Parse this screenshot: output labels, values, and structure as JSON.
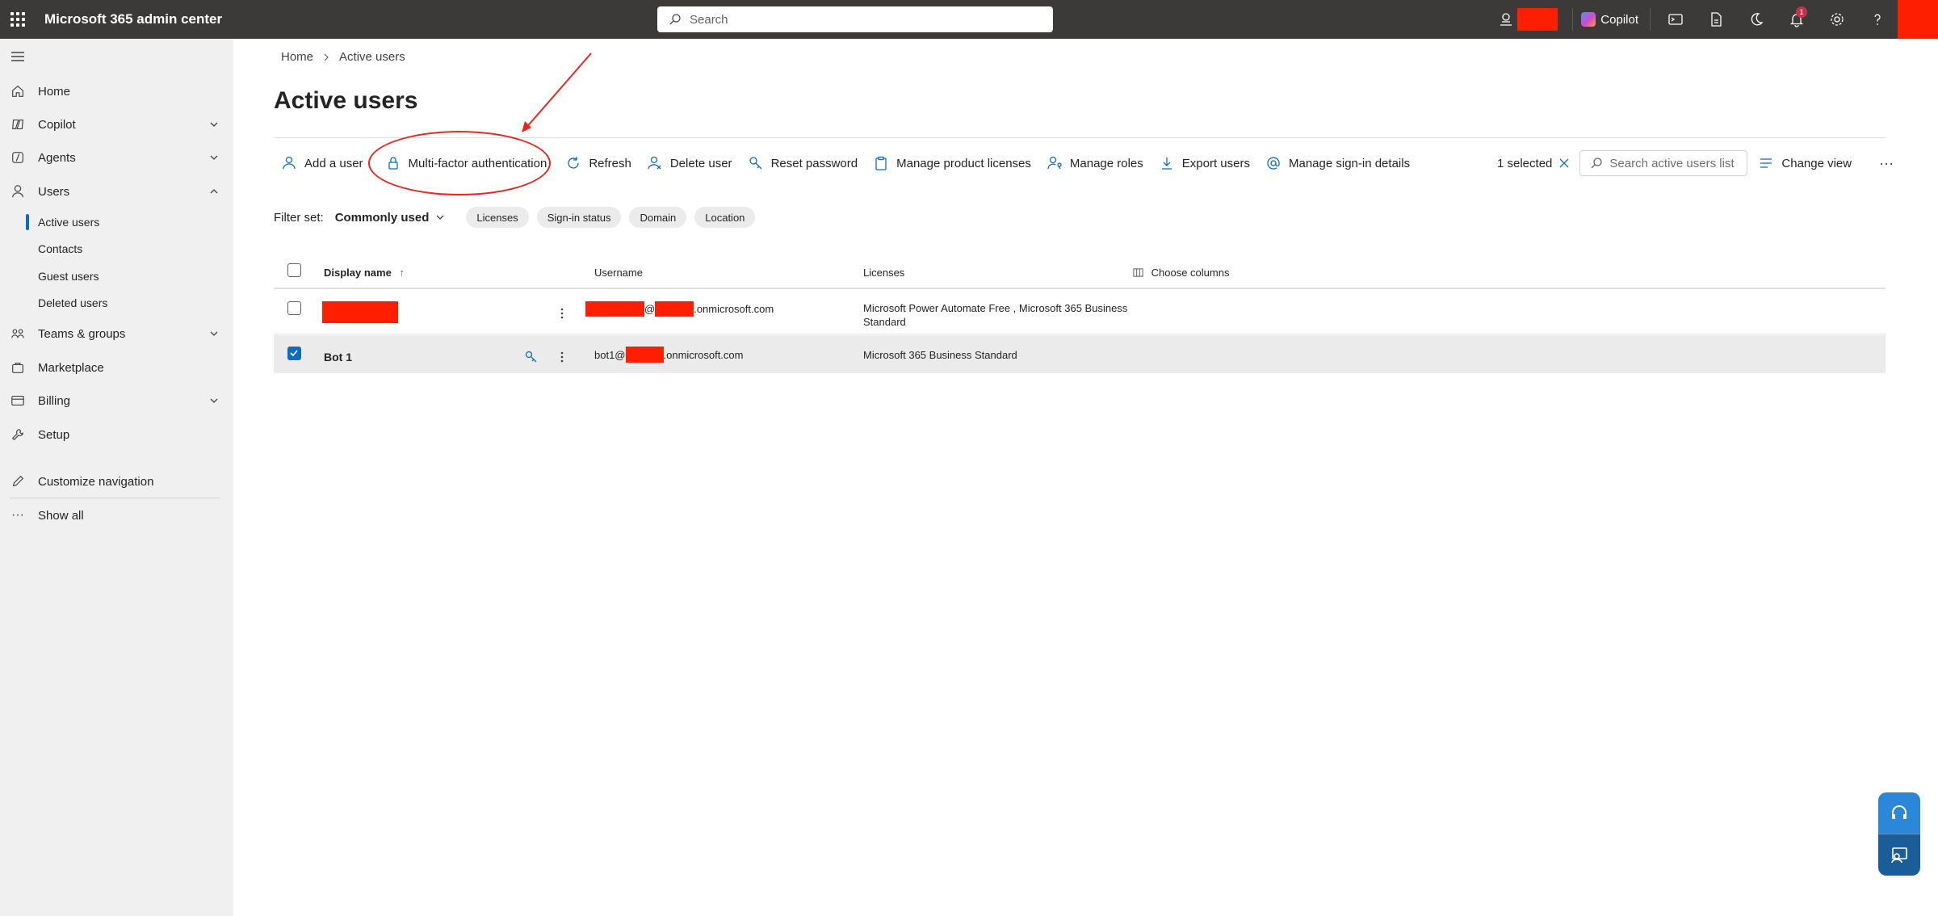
{
  "header": {
    "app_title": "Microsoft 365 admin center",
    "search_placeholder": "Search",
    "copilot_label": "Copilot",
    "notification_count": "1"
  },
  "nav": {
    "items": [
      {
        "label": "Home",
        "icon": "home-icon"
      },
      {
        "label": "Copilot",
        "icon": "copilot-icon"
      },
      {
        "label": "Agents",
        "icon": "agents-icon"
      },
      {
        "label": "Users",
        "icon": "person-icon"
      },
      {
        "label": "Teams & groups",
        "icon": "teams-icon"
      },
      {
        "label": "Marketplace",
        "icon": "bag-icon"
      },
      {
        "label": "Billing",
        "icon": "card-icon"
      },
      {
        "label": "Setup",
        "icon": "wrench-icon"
      },
      {
        "label": "Customize navigation",
        "icon": "pencil-icon"
      },
      {
        "label": "Show all",
        "icon": "more-icon"
      }
    ],
    "users_sub": [
      "Active users",
      "Contacts",
      "Guest users",
      "Deleted users"
    ]
  },
  "breadcrumb": {
    "home": "Home",
    "current": "Active users"
  },
  "page_title": "Active users",
  "toolbar": {
    "add_user": "Add a user",
    "mfa": "Multi-factor authentication",
    "refresh": "Refresh",
    "delete_user": "Delete user",
    "reset_password": "Reset password",
    "manage_licenses": "Manage product licenses",
    "manage_roles": "Manage roles",
    "export_users": "Export users",
    "manage_signin": "Manage sign-in details",
    "selected": "1 selected",
    "search_placeholder": "Search active users list",
    "change_view": "Change view"
  },
  "filter": {
    "label": "Filter set:",
    "value": "Commonly used",
    "pills": [
      "Licenses",
      "Sign-in status",
      "Domain",
      "Location"
    ]
  },
  "table": {
    "columns": {
      "display_name": "Display name",
      "username": "Username",
      "licenses": "Licenses",
      "choose_columns": "Choose columns"
    },
    "rows": [
      {
        "display_name": "",
        "username_at": "@",
        "username_domain": ".onmicrosoft.com",
        "licenses_line1": "Microsoft Power Automate Free , Microsoft 365 Business",
        "licenses_line2": "Standard",
        "checked": false
      },
      {
        "display_name": "Bot 1",
        "username_prefix": "bot1@",
        "username_domain": ".onmicrosoft.com",
        "licenses_line1": "Microsoft 365 Business Standard",
        "checked": true
      }
    ]
  },
  "colors": {
    "accent": "#0f6cbd",
    "redaction": "#fe1e00",
    "annotation": "#e8261e",
    "topbar": "#3b3a39"
  }
}
